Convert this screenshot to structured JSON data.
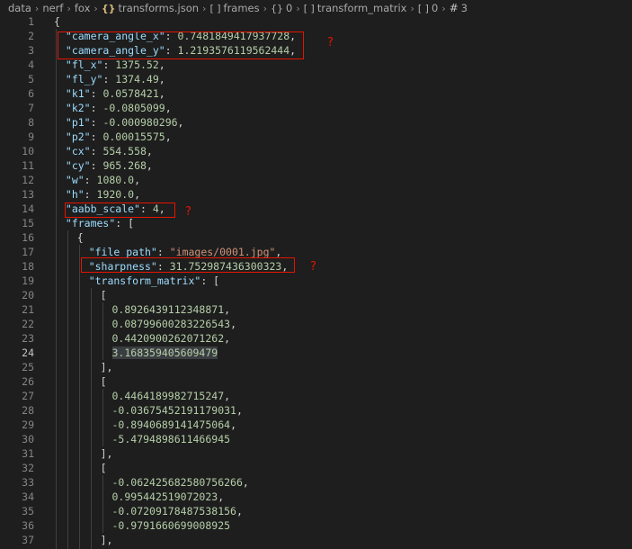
{
  "breadcrumb": {
    "items": [
      "data",
      "nerf",
      "fox",
      "transforms.json",
      "frames",
      "0",
      "transform_matrix",
      "0",
      "3"
    ]
  },
  "annotations": {
    "mark": "?"
  },
  "editor": {
    "active_line": 24,
    "lines": [
      {
        "n": "1",
        "indent": 0,
        "parts": [
          [
            "pun",
            "{"
          ]
        ]
      },
      {
        "n": "2",
        "indent": 1,
        "parts": [
          [
            "key",
            "\"camera_angle_x\""
          ],
          [
            "pun",
            ": "
          ],
          [
            "num",
            "0.7481849417937728"
          ],
          [
            "pun",
            ","
          ]
        ]
      },
      {
        "n": "3",
        "indent": 1,
        "parts": [
          [
            "key",
            "\"camera_angle_y\""
          ],
          [
            "pun",
            ": "
          ],
          [
            "num",
            "1.2193576119562444"
          ],
          [
            "pun",
            ","
          ]
        ]
      },
      {
        "n": "4",
        "indent": 1,
        "parts": [
          [
            "key",
            "\"fl_x\""
          ],
          [
            "pun",
            ": "
          ],
          [
            "num",
            "1375.52"
          ],
          [
            "pun",
            ","
          ]
        ]
      },
      {
        "n": "5",
        "indent": 1,
        "parts": [
          [
            "key",
            "\"fl_y\""
          ],
          [
            "pun",
            ": "
          ],
          [
            "num",
            "1374.49"
          ],
          [
            "pun",
            ","
          ]
        ]
      },
      {
        "n": "6",
        "indent": 1,
        "parts": [
          [
            "key",
            "\"k1\""
          ],
          [
            "pun",
            ": "
          ],
          [
            "num",
            "0.0578421"
          ],
          [
            "pun",
            ","
          ]
        ]
      },
      {
        "n": "7",
        "indent": 1,
        "parts": [
          [
            "key",
            "\"k2\""
          ],
          [
            "pun",
            ": "
          ],
          [
            "num",
            "-0.0805099"
          ],
          [
            "pun",
            ","
          ]
        ]
      },
      {
        "n": "8",
        "indent": 1,
        "parts": [
          [
            "key",
            "\"p1\""
          ],
          [
            "pun",
            ": "
          ],
          [
            "num",
            "-0.000980296"
          ],
          [
            "pun",
            ","
          ]
        ]
      },
      {
        "n": "9",
        "indent": 1,
        "parts": [
          [
            "key",
            "\"p2\""
          ],
          [
            "pun",
            ": "
          ],
          [
            "num",
            "0.00015575"
          ],
          [
            "pun",
            ","
          ]
        ]
      },
      {
        "n": "10",
        "indent": 1,
        "parts": [
          [
            "key",
            "\"cx\""
          ],
          [
            "pun",
            ": "
          ],
          [
            "num",
            "554.558"
          ],
          [
            "pun",
            ","
          ]
        ]
      },
      {
        "n": "11",
        "indent": 1,
        "parts": [
          [
            "key",
            "\"cy\""
          ],
          [
            "pun",
            ": "
          ],
          [
            "num",
            "965.268"
          ],
          [
            "pun",
            ","
          ]
        ]
      },
      {
        "n": "12",
        "indent": 1,
        "parts": [
          [
            "key",
            "\"w\""
          ],
          [
            "pun",
            ": "
          ],
          [
            "num",
            "1080.0"
          ],
          [
            "pun",
            ","
          ]
        ]
      },
      {
        "n": "13",
        "indent": 1,
        "parts": [
          [
            "key",
            "\"h\""
          ],
          [
            "pun",
            ": "
          ],
          [
            "num",
            "1920.0"
          ],
          [
            "pun",
            ","
          ]
        ]
      },
      {
        "n": "14",
        "indent": 1,
        "parts": [
          [
            "key",
            "\"aabb_scale\""
          ],
          [
            "pun",
            ": "
          ],
          [
            "num",
            "4"
          ],
          [
            "pun",
            ","
          ]
        ]
      },
      {
        "n": "15",
        "indent": 1,
        "parts": [
          [
            "key",
            "\"frames\""
          ],
          [
            "pun",
            ": ["
          ]
        ]
      },
      {
        "n": "16",
        "indent": 2,
        "parts": [
          [
            "pun",
            "{"
          ]
        ]
      },
      {
        "n": "17",
        "indent": 3,
        "parts": [
          [
            "key",
            "\"file_path\""
          ],
          [
            "pun",
            ": "
          ],
          [
            "str",
            "\"images/0001.jpg\""
          ],
          [
            "pun",
            ","
          ]
        ]
      },
      {
        "n": "18",
        "indent": 3,
        "parts": [
          [
            "key",
            "\"sharpness\""
          ],
          [
            "pun",
            ": "
          ],
          [
            "num",
            "31.752987436300323"
          ],
          [
            "pun",
            ","
          ]
        ]
      },
      {
        "n": "19",
        "indent": 3,
        "parts": [
          [
            "key",
            "\"transform_matrix\""
          ],
          [
            "pun",
            ": ["
          ]
        ]
      },
      {
        "n": "20",
        "indent": 4,
        "parts": [
          [
            "pun",
            "["
          ]
        ]
      },
      {
        "n": "21",
        "indent": 5,
        "parts": [
          [
            "num",
            "0.8926439112348871"
          ],
          [
            "pun",
            ","
          ]
        ]
      },
      {
        "n": "22",
        "indent": 5,
        "parts": [
          [
            "num",
            "0.08799600283226543"
          ],
          [
            "pun",
            ","
          ]
        ]
      },
      {
        "n": "23",
        "indent": 5,
        "parts": [
          [
            "num",
            "0.4420900262071262"
          ],
          [
            "pun",
            ","
          ]
        ]
      },
      {
        "n": "24",
        "indent": 5,
        "parts": [
          [
            "num",
            "3.168359405609479"
          ]
        ]
      },
      {
        "n": "25",
        "indent": 4,
        "parts": [
          [
            "pun",
            "],"
          ]
        ]
      },
      {
        "n": "26",
        "indent": 4,
        "parts": [
          [
            "pun",
            "["
          ]
        ]
      },
      {
        "n": "27",
        "indent": 5,
        "parts": [
          [
            "num",
            "0.4464189982715247"
          ],
          [
            "pun",
            ","
          ]
        ]
      },
      {
        "n": "28",
        "indent": 5,
        "parts": [
          [
            "num",
            "-0.03675452191179031"
          ],
          [
            "pun",
            ","
          ]
        ]
      },
      {
        "n": "29",
        "indent": 5,
        "parts": [
          [
            "num",
            "-0.8940689141475064"
          ],
          [
            "pun",
            ","
          ]
        ]
      },
      {
        "n": "30",
        "indent": 5,
        "parts": [
          [
            "num",
            "-5.4794898611466945"
          ]
        ]
      },
      {
        "n": "31",
        "indent": 4,
        "parts": [
          [
            "pun",
            "],"
          ]
        ]
      },
      {
        "n": "32",
        "indent": 4,
        "parts": [
          [
            "pun",
            "["
          ]
        ]
      },
      {
        "n": "33",
        "indent": 5,
        "parts": [
          [
            "num",
            "-0.062425682580756266"
          ],
          [
            "pun",
            ","
          ]
        ]
      },
      {
        "n": "34",
        "indent": 5,
        "parts": [
          [
            "num",
            "0.995442519072023"
          ],
          [
            "pun",
            ","
          ]
        ]
      },
      {
        "n": "35",
        "indent": 5,
        "parts": [
          [
            "num",
            "-0.07209178487538156"
          ],
          [
            "pun",
            ","
          ]
        ]
      },
      {
        "n": "36",
        "indent": 5,
        "parts": [
          [
            "num",
            "-0.9791660699008925"
          ]
        ]
      },
      {
        "n": "37",
        "indent": 4,
        "parts": [
          [
            "pun",
            "],"
          ]
        ]
      }
    ]
  }
}
